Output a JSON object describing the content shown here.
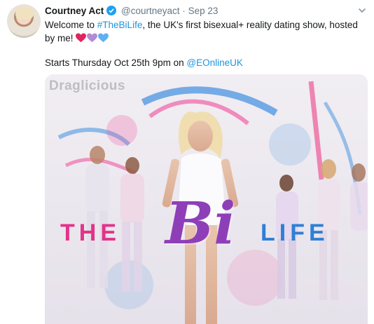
{
  "tweet": {
    "author_name": "Courtney Act",
    "handle": "@courtneyact",
    "separator": "·",
    "timestamp": "Sep 23",
    "text_part1": "Welcome to ",
    "hashtag": "#TheBiLife",
    "text_part2": ", the UK's first bisexual+ reality dating show, hosted by me! ",
    "hearts": [
      "red-heart-icon",
      "purple-heart-icon",
      "blue-heart-icon"
    ],
    "line2_prefix": "Starts Thursday Oct 25th 9pm on ",
    "mention": "@EOnlineUK"
  },
  "media": {
    "watermark": "Draglicious",
    "logo_the": "THE",
    "logo_bi": "Bi",
    "logo_life": "LIFE"
  },
  "colors": {
    "link": "#1b95e0",
    "verified": "#1da1f2",
    "heart_red": "#e0245e",
    "heart_purple": "#b48ad8",
    "heart_blue": "#5fb0f0"
  }
}
